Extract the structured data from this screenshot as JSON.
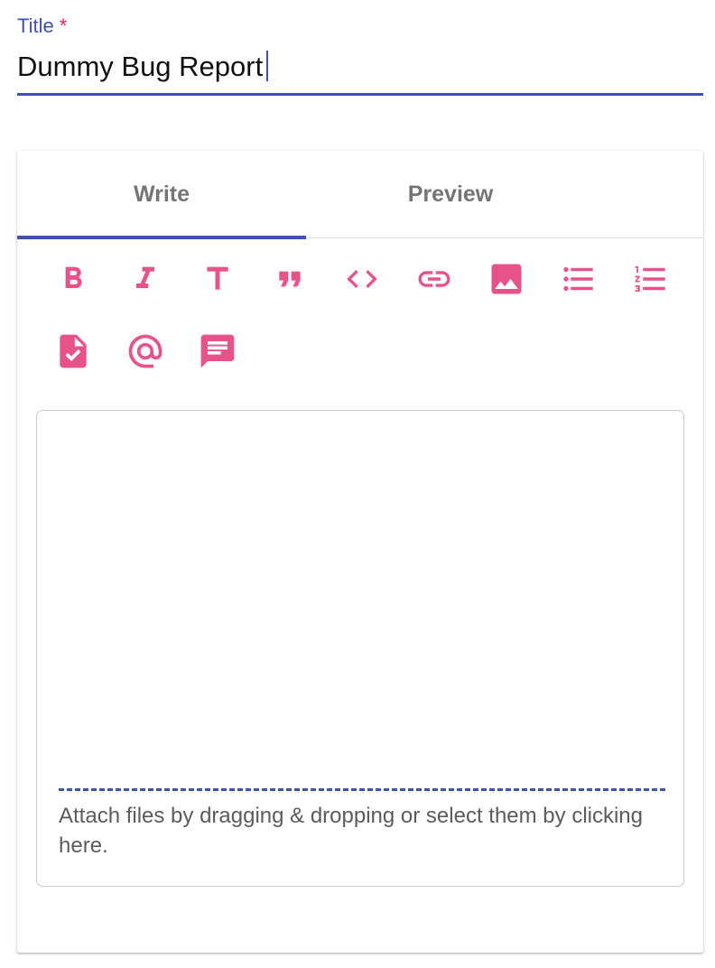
{
  "title_field": {
    "label": "Title",
    "required_marker": "*",
    "value": "Dummy Bug Report"
  },
  "editor": {
    "tabs": [
      {
        "label": "Write",
        "active": true
      },
      {
        "label": "Preview",
        "active": false
      }
    ],
    "toolbar": [
      {
        "icon": "bold-icon"
      },
      {
        "icon": "italic-icon"
      },
      {
        "icon": "heading-icon"
      },
      {
        "icon": "quote-icon"
      },
      {
        "icon": "code-icon"
      },
      {
        "icon": "link-icon"
      },
      {
        "icon": "image-icon"
      },
      {
        "icon": "bulleted-list-icon"
      },
      {
        "icon": "numbered-list-icon"
      },
      {
        "icon": "task-list-icon"
      },
      {
        "icon": "mention-icon"
      },
      {
        "icon": "saved-reply-icon"
      }
    ],
    "body_value": "",
    "attach_hint": "Attach files by dragging & dropping or select them by clicking here."
  },
  "colors": {
    "accent": "#3f51b5",
    "icon": "#e8528a",
    "required": "#e91e63",
    "tab_text": "#757575"
  }
}
